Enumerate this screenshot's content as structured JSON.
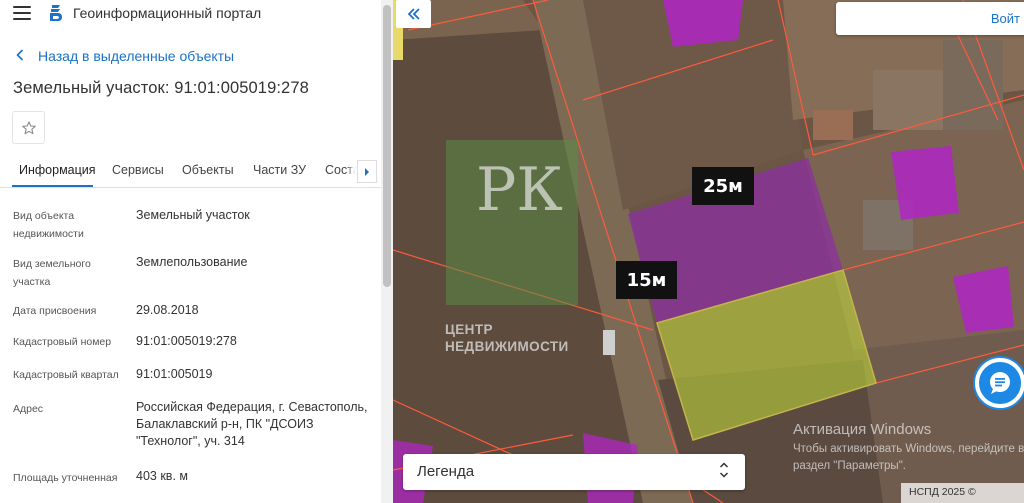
{
  "header": {
    "menu_icon": "hamburger-icon",
    "logo_icon": "portal-logo-icon",
    "title": "Геоинформационный портал"
  },
  "back_link": "Назад в выделенные объекты",
  "page_title": "Земельный участок: 91:01:005019:278",
  "favorite_icon": "star-outline-icon",
  "tabs": [
    {
      "label": "Информация",
      "active": true
    },
    {
      "label": "Сервисы",
      "active": false
    },
    {
      "label": "Объекты",
      "active": false
    },
    {
      "label": "Части ЗУ",
      "active": false
    },
    {
      "label": "Соста",
      "active": false
    }
  ],
  "info": [
    {
      "label": "Вид объекта недвижимости",
      "value": "Земельный участок"
    },
    {
      "label": "Вид земельного участка",
      "value": "Землепользование"
    },
    {
      "label": "Дата присвоения",
      "value": "29.08.2018"
    },
    {
      "label": "Кадастровый номер",
      "value": "91:01:005019:278"
    },
    {
      "label": "Кадастровый квартал",
      "value": "91:01:005019"
    },
    {
      "label": "Адрес",
      "value": "Российская Федерация, г. Севастополь, Балаклавский р-н, ПК \"ДСОИЗ \"Технолог\", уч. 314"
    },
    {
      "label": "Площадь уточненная",
      "value": "403 кв. м"
    }
  ],
  "map": {
    "search_label": "Войт",
    "dimension_labels": [
      "25м",
      "15м"
    ],
    "watermark": {
      "letters": "РК",
      "line1": "ЦЕНТР",
      "line2": "НЕДВИЖИМОСТИ"
    },
    "legend_label": "Легенда",
    "windows_activation": {
      "title": "Активация Windows",
      "hint": "Чтобы активировать Windows, перейдите в раздел \"Параметры\"."
    },
    "footer": "НСПД 2025 ©",
    "colors": {
      "parcel_selected": "#c7e03a",
      "parcel_neighbor": "#b026c4",
      "boundary": "#ff5a3c",
      "accent": "#1a73c8"
    }
  }
}
